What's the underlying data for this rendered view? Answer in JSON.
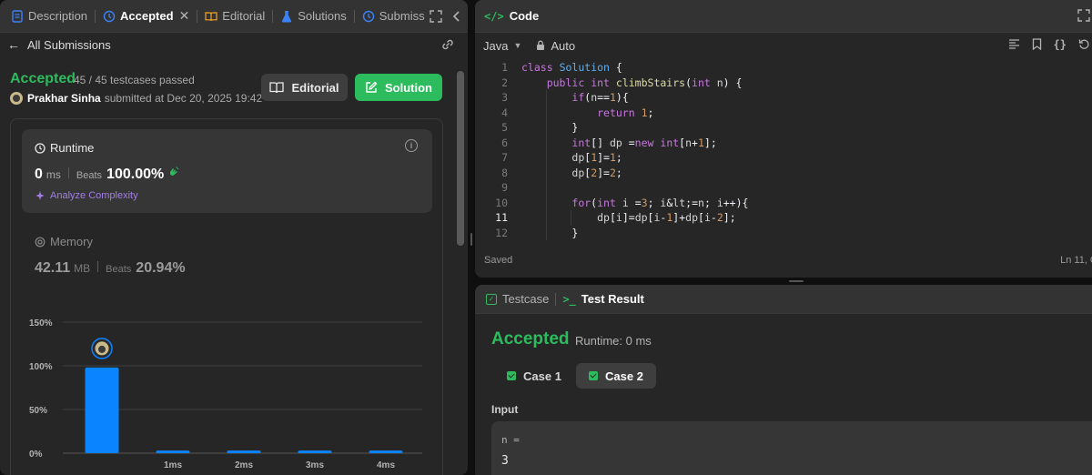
{
  "left_tabs": [
    {
      "label": "Description"
    },
    {
      "label": "Accepted"
    },
    {
      "label": "Editorial"
    },
    {
      "label": "Solutions"
    },
    {
      "label": "Submiss"
    }
  ],
  "sub_header": {
    "back_label": "All Submissions"
  },
  "submission": {
    "status": "Accepted",
    "testcases": "45 / 45 testcases passed",
    "user": "Prakhar Sinha",
    "submitted_text": "submitted at Dec 20, 2025 19:42",
    "editorial_button": "Editorial",
    "solution_button": "Solution"
  },
  "runtime": {
    "label": "Runtime",
    "value": "0",
    "unit": "ms",
    "beats_label": "Beats",
    "beats_value": "100.00%",
    "analyze_label": "Analyze Complexity"
  },
  "memory": {
    "label": "Memory",
    "value": "42.11",
    "unit": "MB",
    "beats_label": "Beats",
    "beats_value": "20.94%"
  },
  "chart_data": {
    "type": "bar",
    "categories": [
      "",
      "1ms",
      "2ms",
      "3ms",
      "4ms"
    ],
    "values": [
      98,
      3,
      3,
      3,
      3
    ],
    "yticks": [
      "150%",
      "100%",
      "50%",
      "0%"
    ],
    "ylim": [
      0,
      150
    ],
    "bar_color": "#0a84ff",
    "highlight_index": 0
  },
  "code_panel": {
    "title": "Code",
    "language": "Java",
    "mode": "Auto",
    "status": "Saved",
    "cursor": "Ln 11, Co",
    "lines": [
      "class Solution {",
      "    public int climbStairs(int n) {",
      "        if(n==1){",
      "            return 1;",
      "        }",
      "        int[] dp =new int[n+1];",
      "        dp[1]=1;",
      "        dp[2]=2;",
      "",
      "        for(int i =3; i<=n; i++){",
      "            dp[i]=dp[i-1]+dp[i-2];",
      "        }"
    ]
  },
  "result_panel": {
    "tab_testcase": "Testcase",
    "tab_result": "Test Result",
    "status": "Accepted",
    "runtime": "Runtime: 0 ms",
    "case1": "Case 1",
    "case2": "Case 2",
    "input_label": "Input",
    "input_name": "n =",
    "input_value": "3"
  },
  "colors": {
    "accent_green": "#2cbb5d",
    "purple": "#a37dea",
    "bar_blue": "#0a84ff"
  }
}
